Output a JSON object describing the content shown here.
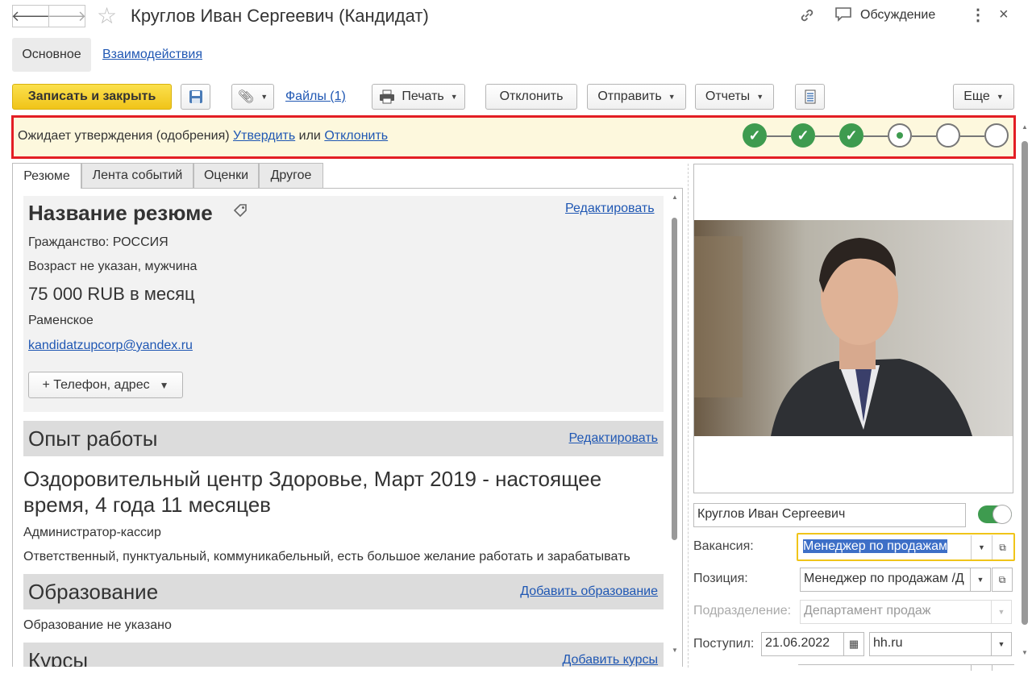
{
  "header": {
    "title": "Круглов Иван Сергеевич (Кандидат)",
    "discussion": "Обсуждение"
  },
  "nav_tabs": [
    "Основное",
    "Взаимодействия"
  ],
  "toolbar": {
    "save_close": "Записать и закрыть",
    "files": "Файлы (1)",
    "print": "Печать",
    "reject": "Отклонить",
    "send": "Отправить",
    "reports": "Отчеты",
    "more": "Еще"
  },
  "status": {
    "text": "Ожидает утверждения (одобрения)",
    "approve": "Утвердить",
    "or": "или",
    "reject": "Отклонить",
    "steps": [
      "done",
      "done",
      "done",
      "current",
      "todo",
      "todo"
    ]
  },
  "tabs": [
    "Резюме",
    "Лента событий",
    "Оценки",
    "Другое"
  ],
  "resume": {
    "title": "Название резюме",
    "edit": "Редактировать",
    "citizenship": "Гражданство: РОССИЯ",
    "age": "Возраст не указан, мужчина",
    "salary": "75 000 RUB в месяц",
    "city": "Раменское",
    "email": "kandidatzupcorp@yandex.ru",
    "phone_button": "+ Телефон, адрес"
  },
  "experience": {
    "title": "Опыт работы",
    "edit": "Редактировать",
    "company": "Оздоровительный центр Здоровье, Март 2019 - настоящее время, 4 года 11 месяцев",
    "position": "Администратор-кассир",
    "description": "Ответственный, пунктуальный, коммуникабельный, есть большое желание работать и зарабатывать"
  },
  "education": {
    "title": "Образование",
    "add": "Добавить образование",
    "empty": "Образование не указано"
  },
  "courses": {
    "title": "Курсы",
    "add": "Добавить курсы"
  },
  "candidate": {
    "name": "Круглов Иван Сергеевич",
    "vacancy_label": "Вакансия:",
    "vacancy": "Менеджер по продажам",
    "position_label": "Позиция:",
    "position": "Менеджер по продажам /Д",
    "department_label": "Подразделение:",
    "department": "Департамент продаж",
    "received_label": "Поступил:",
    "received_date": "21.06.2022",
    "source": "hh.ru"
  },
  "colors": {
    "accent_yellow": "#f5d42c",
    "status_border": "#e31e24",
    "status_bg": "#fdf8dd",
    "step_done": "#3e9b4f",
    "link": "#1f57b3"
  }
}
